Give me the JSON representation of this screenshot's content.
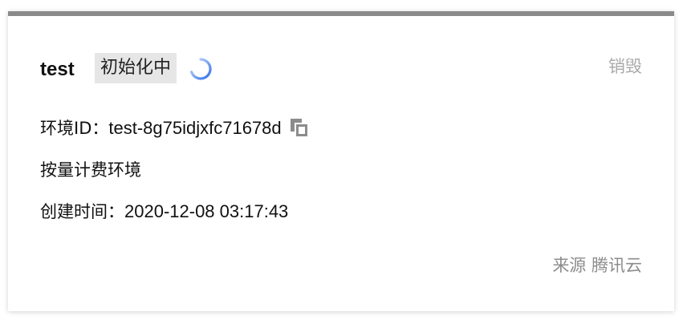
{
  "card": {
    "name": "test",
    "status": "初始化中",
    "destroy_label": "销毁",
    "env_id_label": "环境ID：",
    "env_id": "test-8g75idjxfc71678d",
    "billing": "按量计费环境",
    "created_label": "创建时间：",
    "created_time": "2020-12-08 03:17:43",
    "source_label": "来源",
    "source_value": "腾讯云"
  },
  "icons": {
    "spinner": "loading-spinner-icon",
    "copy": "copy-icon"
  },
  "colors": {
    "top_bar": "#8a8a8a",
    "badge_bg": "#e6e6e6",
    "spinner": "#3b82f6",
    "muted_text": "#aaaaaa"
  }
}
